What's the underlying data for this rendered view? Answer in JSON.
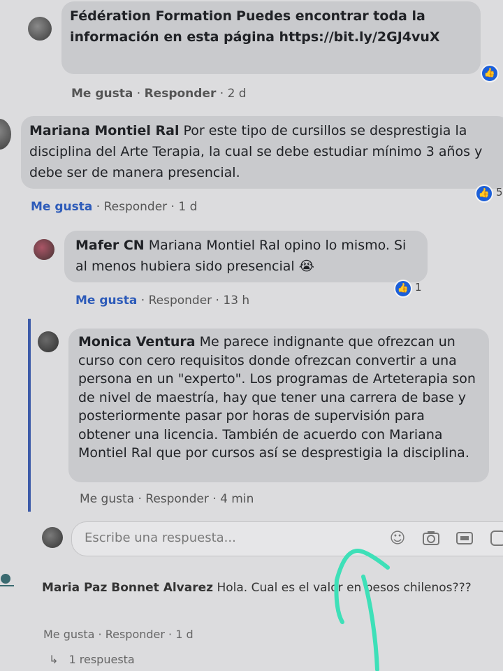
{
  "comments": [
    {
      "author": "Fédération Formation",
      "text": "Puedes encontrar toda la información en esta página https://bit.ly/2GJ4vuX",
      "like": "Me gusta",
      "reply": "Responder",
      "time": "2 d"
    },
    {
      "author": "Mariana Montiel Ral",
      "text": "Por este tipo de cursillos se desprestigia la disciplina del Arte Terapia, la cual se debe estudiar mínimo 3 años y debe ser de manera presencial.",
      "like": "Me gusta",
      "reply": "Responder",
      "time": "1 d",
      "reaction_count": "5"
    },
    {
      "author": "Mafer CN",
      "text": "Mariana Montiel Ral opino lo mismo. Si al menos hubiera sido presencial 😭",
      "like": "Me gusta",
      "reply": "Responder",
      "time": "13 h",
      "reaction_count": "1"
    },
    {
      "author": "Monica Ventura",
      "text": "Me parece indignante que ofrezcan un curso con cero requisitos donde ofrezcan convertir a una persona en un \"experto\". Los programas de Arteterapia son de nivel de maestría, hay que tener una carrera de base y posteriormente pasar por horas de supervisión para obtener una licencia. También de acuerdo con Mariana Montiel Ral que por cursos así se desprestigia la disciplina.",
      "like": "Me gusta",
      "reply": "Responder",
      "time": "4 min"
    },
    {
      "author": "Maria Paz Bonnet Alvarez",
      "text": "Hola. Cual es el valor en pesos chilenos???",
      "like": "Me gusta",
      "reply": "Responder",
      "time": "1 d"
    }
  ],
  "reply_box": {
    "placeholder": "Escribe una respuesta..."
  },
  "view_replies": "1 respuesta",
  "separator": " · ",
  "icons": {
    "like_reaction": "thumbs-up-icon",
    "emoji": "emoji-icon",
    "camera": "camera-icon",
    "gif": "gif-icon",
    "sticker": "sticker-icon",
    "reply_arrow": "reply-arrow-icon"
  },
  "colors": {
    "like_blue": "#2d5bb9",
    "reaction_blue": "#1c5fd8",
    "thread_line": "#3c5aa8",
    "annotation": "#3ee0b8"
  }
}
